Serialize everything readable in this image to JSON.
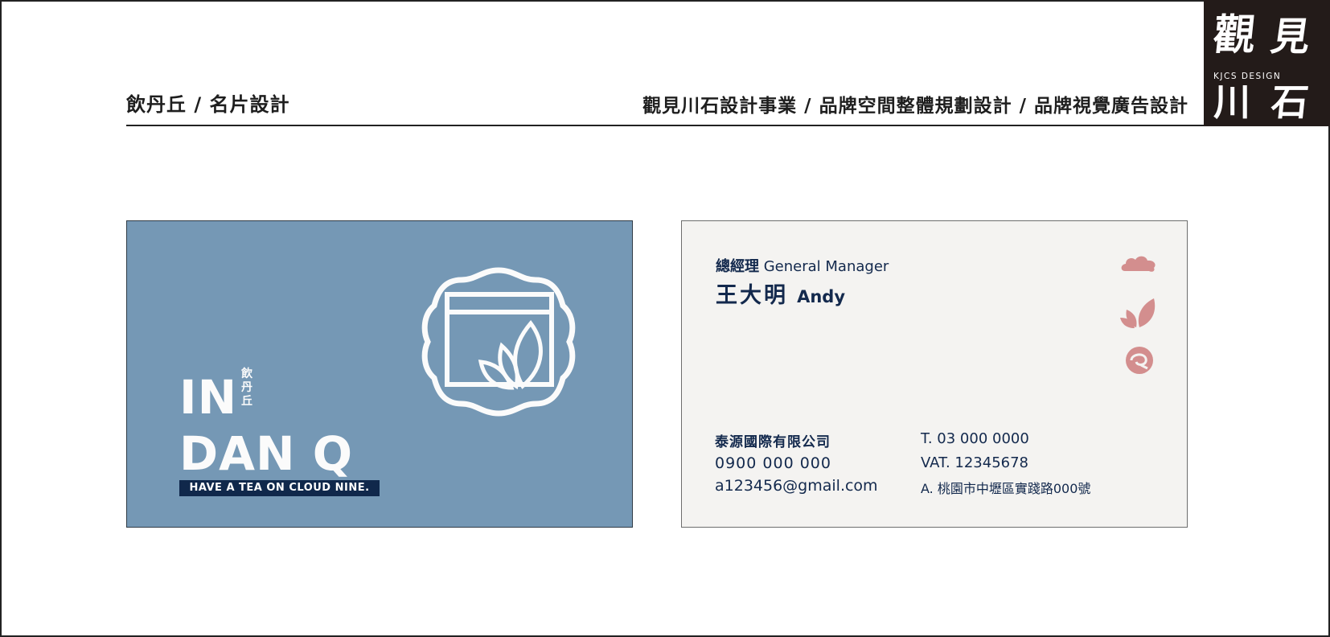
{
  "header": {
    "left_title": "飲丹丘 / 名片設計",
    "right_title": "觀見川石設計事業 / 品牌空間整體規劃設計 / 品牌視覺廣告設計"
  },
  "logo": {
    "glyphs": [
      "觀",
      "見",
      "川",
      "石"
    ],
    "text": "KJCS DESIGN"
  },
  "card_front": {
    "brand_line1": "IN",
    "brand_line2": "DAN Q",
    "brand_cjk": "飲丹丘",
    "slogan": "HAVE A TEA ON CLOUD NINE.",
    "colors": {
      "background": "#7598b5",
      "mark": "#fbfbfb",
      "slogan_bg": "#10284b"
    },
    "emblem_icon": "tea-leaf-cloud-badge-icon"
  },
  "card_back": {
    "title_cjk": "總經理",
    "title_en": "General Manager",
    "name_cjk": "王大明",
    "name_en": "Andy",
    "company": "泰源國際有限公司",
    "mobile": "0900 000 000",
    "email": "a123456@gmail.com",
    "tel": "T. 03 000 0000",
    "vat": "VAT. 12345678",
    "address": "A. 桃園市中壢區實踐路000號",
    "colors": {
      "background": "#f4f3f1",
      "text": "#13294d",
      "icon": "#d38e8e"
    },
    "icons": [
      "cloud-icon",
      "leaf-icon",
      "swirl-badge-icon"
    ]
  }
}
